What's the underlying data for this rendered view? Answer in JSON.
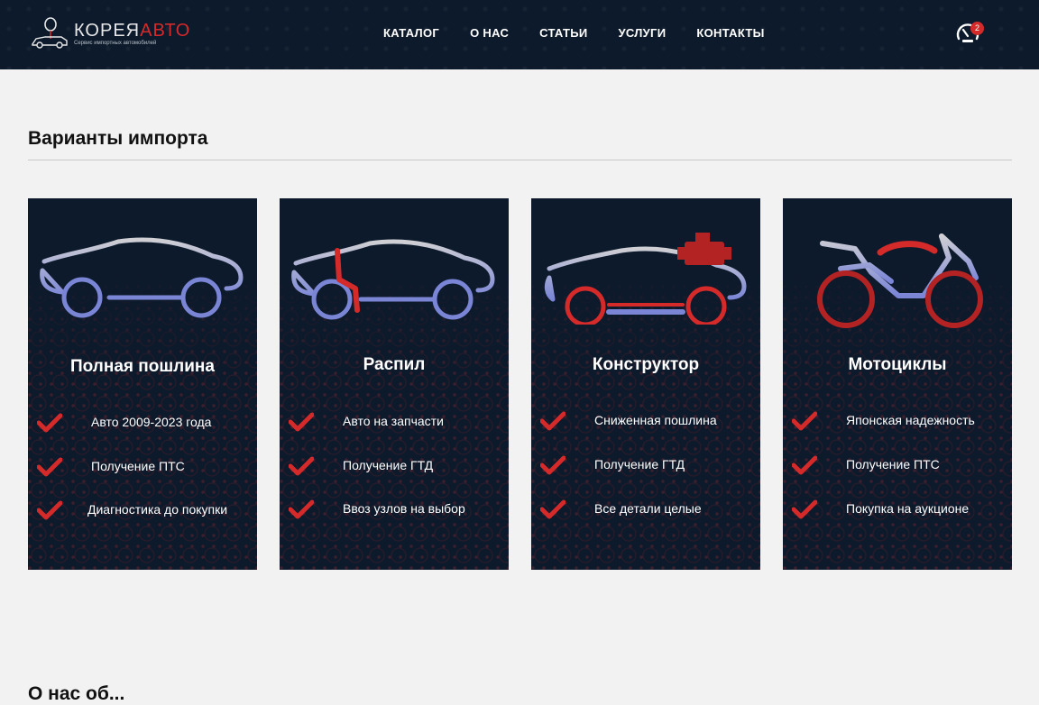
{
  "brand": {
    "name_part1": "КОРЕЯ",
    "name_part2": "АВТО",
    "tagline": "Сервис импортных автомобилей"
  },
  "nav": {
    "items": [
      "КАТАЛОГ",
      "О НАС",
      "СТАТЬИ",
      "УСЛУГИ",
      "КОНТАКТЫ"
    ]
  },
  "compare": {
    "icon": "gauge-icon",
    "count": "2"
  },
  "section": {
    "title": "Варианты импорта"
  },
  "cards": [
    {
      "title": "Полная пошлина",
      "features": [
        "Авто 2009-2023 года",
        "Получение ПТС",
        "Диагностика до покупки"
      ]
    },
    {
      "title": "Распил",
      "features": [
        "Авто на запчасти",
        "Получение ГТД",
        "Ввоз узлов на выбор"
      ]
    },
    {
      "title": "Конструктор",
      "features": [
        "Сниженная пошлина",
        "Получение ГТД",
        "Все детали целые"
      ]
    },
    {
      "title": "Мотоциклы",
      "features": [
        "Японская надежность",
        "Получение ПТС",
        "Покупка на аукционе"
      ]
    }
  ],
  "colors": {
    "header_bg": "#0c1a2b",
    "accent_red": "#d42a2a",
    "page_bg": "#f2f2f2"
  },
  "next_section": {
    "title": "О нас об..."
  }
}
